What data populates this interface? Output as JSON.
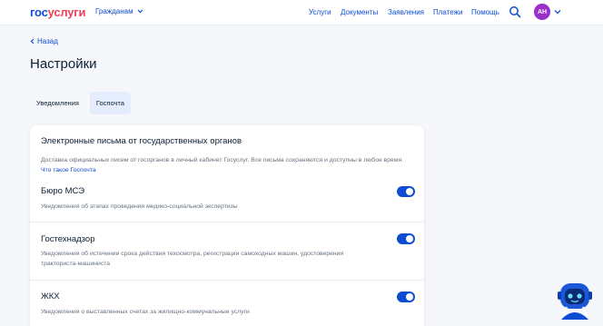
{
  "header": {
    "logo_part1": "гос",
    "logo_part2": "услуги",
    "audience_selector": "Гражданам",
    "nav": [
      "Услуги",
      "Документы",
      "Заявления",
      "Платежи",
      "Помощь"
    ],
    "avatar_initials": "АН"
  },
  "back_label": "Назад",
  "page_title": "Настройки",
  "tabs": [
    {
      "label": "Уведомления",
      "active": false
    },
    {
      "label": "Госпочта",
      "active": true
    }
  ],
  "card": {
    "title": "Электронные письма от государственных органов",
    "description": "Доставка официальных писем от госорганов в личный кабинет Госуслуг. Все письма сохраняются и доступны в любое время.",
    "description_link": "Что такое Госпочта",
    "rows": [
      {
        "title": "Бюро МСЭ",
        "description": "Уведомления об этапах проведения медико-социальной экспертизы",
        "enabled": true
      },
      {
        "title": "Гостехнадзор",
        "description": "Уведомления об истечении срока действия техосмотра, регистрации самоходных машин, удостоверения тракториста-машиниста",
        "enabled": true
      },
      {
        "title": "ЖКХ",
        "description": "Уведомления о выставленных счетах за жилищно-коммунальные услуги",
        "enabled": true
      }
    ]
  },
  "colors": {
    "brand_blue": "#0d4cd3",
    "brand_red": "#ee3f58",
    "avatar_purple": "#9a2fc9",
    "page_bg": "#f5f7fa",
    "tab_active_bg": "#e4ecfd"
  },
  "icons": {
    "search": "search-icon",
    "chevron_down": "chevron-down-icon",
    "chevron_left": "chevron-left-icon",
    "assistant": "robot-assistant-icon"
  }
}
